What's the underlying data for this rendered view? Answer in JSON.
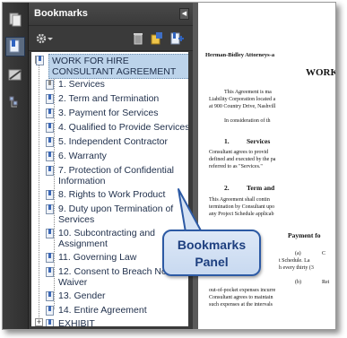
{
  "panel": {
    "title": "Bookmarks",
    "collapse_icon": "triangle-left-icon"
  },
  "toolbar": {
    "options_icon": "gear-icon",
    "delete_icon": "trash-icon",
    "expand_icon": "expand-bookmark-icon",
    "new_icon": "new-bookmark-icon"
  },
  "nav": {
    "items": [
      "page-thumbnails-icon",
      "bookmarks-icon",
      "signatures-icon",
      "layers-icon"
    ]
  },
  "bookmarks": {
    "root": "WORK FOR HIRE CONSULTANT AGREEMENT",
    "items": [
      {
        "label": "1. Services",
        "gray": true
      },
      {
        "label": "2. Term and Termination"
      },
      {
        "label": "3. Payment for Services"
      },
      {
        "label": "4. Qualified to Provide Services"
      },
      {
        "label": "5. Independent Contractor"
      },
      {
        "label": "6. Warranty"
      },
      {
        "label": "7. Protection of Confidential Information"
      },
      {
        "label": "8. Rights to Work Product"
      },
      {
        "label": "9. Duty upon Termination of Services"
      },
      {
        "label": "10. Subcontracting and Assignment"
      },
      {
        "label": "11. Governing Law"
      },
      {
        "label": "12. Consent to Breach Not Waiver"
      },
      {
        "label": "13. Gender"
      },
      {
        "label": "14. Entire Agreement"
      }
    ],
    "next_root": "EXHIBIT"
  },
  "document": {
    "lines": [
      "Herman-Bidley Attorneys-a",
      "WORK",
      "This Agreement is ma",
      "Liability Corporation located a",
      "at 900 Country Drive, Nashvill",
      "In consideration of th",
      "1.",
      "Services",
      "Consultant agrees to provid",
      "defined and executed by the pa",
      "referred to as \"Services.\"",
      "2.",
      "Term and",
      "This Agreement shall contin",
      "termination by Consultant upo",
      "any Project Schedule applicab",
      "Payment fo",
      "(a)",
      "C",
      "t Schedule. La",
      "h every thirty (3",
      "(b)",
      "Rei",
      "out-of-pocket expenses incurre",
      "Consultant agrees to maintain",
      "such expenses at the intervals"
    ]
  },
  "callout": {
    "text": "Bookmarks Panel"
  },
  "colors": {
    "panel_bg": "#3a3a3a",
    "selection": "#bcd3ea",
    "callout_border": "#2d5aa4",
    "callout_text": "#1d3f7f"
  }
}
